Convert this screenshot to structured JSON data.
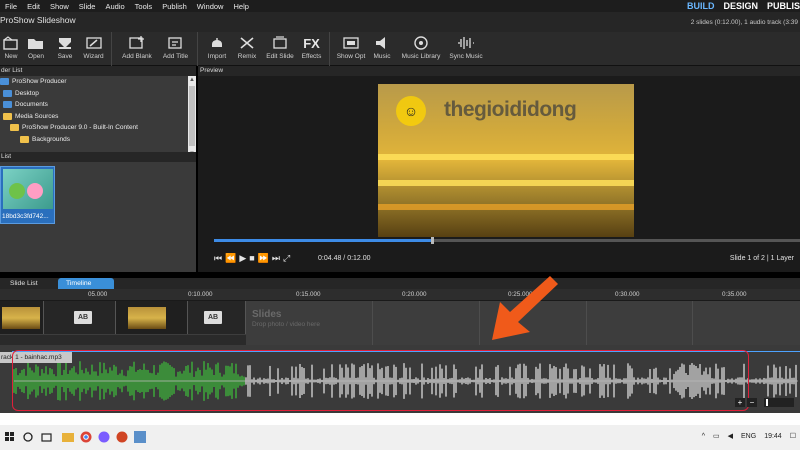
{
  "menu": {
    "items": [
      "File",
      "Edit",
      "Show",
      "Slide",
      "Audio",
      "Tools",
      "Publish",
      "Window",
      "Help"
    ],
    "modes": [
      "BUILD",
      "DESIGN",
      "PUBLIS"
    ]
  },
  "titlebar": {
    "title": "ProShow Slideshow",
    "info": "2 slides (0:12.00), 1 audio track (3:39"
  },
  "toolbar": {
    "buttons": [
      {
        "label": "New",
        "icon": "new-folder-icon"
      },
      {
        "label": "Open",
        "icon": "open-folder-icon"
      },
      {
        "label": "Save",
        "icon": "save-icon"
      },
      {
        "label": "Wizard",
        "icon": "wizard-icon"
      },
      {
        "label": "Add Blank",
        "icon": "add-blank-icon"
      },
      {
        "label": "Add Title",
        "icon": "add-title-icon"
      },
      {
        "label": "Import",
        "icon": "import-icon"
      },
      {
        "label": "Remix",
        "icon": "remix-icon"
      },
      {
        "label": "Edit Slide",
        "icon": "edit-slide-icon"
      },
      {
        "label": "Effects",
        "icon": "fx-icon"
      },
      {
        "label": "Show Opt",
        "icon": "show-options-icon"
      },
      {
        "label": "Music",
        "icon": "music-icon"
      },
      {
        "label": "Music Library",
        "icon": "music-library-icon"
      },
      {
        "label": "Sync Music",
        "icon": "sync-music-icon"
      }
    ],
    "fx_text": "FX"
  },
  "folder_list": {
    "header": "der List",
    "items": [
      {
        "label": "ProShow Producer",
        "icon": "app-icon"
      },
      {
        "label": "Desktop",
        "icon": "desktop-icon"
      },
      {
        "label": "Documents",
        "icon": "documents-icon"
      },
      {
        "label": "Media Sources",
        "icon": "folder-icon"
      },
      {
        "label": "ProShow Producer 9.0 - Built-In Content",
        "icon": "folder-icon"
      },
      {
        "label": "Backgrounds",
        "icon": "folder-icon"
      }
    ]
  },
  "file_list": {
    "header": "List",
    "item_name": "18bd3c3fd742..."
  },
  "preview": {
    "header": "Preview",
    "brand_text": "thegioididong",
    "timecode": "0:04.48 / 0:12.00",
    "slide_info": "Slide 1 of 2  |  1 Layer",
    "progress": 0.37
  },
  "timeline": {
    "tabs": [
      "Slide List",
      "Timeline"
    ],
    "active_tab": "Timeline",
    "ticks": [
      "05.000",
      "0:10.000",
      "0:15.000",
      "0:20.000",
      "0:25.000",
      "0:30.000",
      "0:35.000"
    ],
    "slides_placeholder_title": "Slides",
    "slides_placeholder_sub": "Drop photo / video here",
    "track_label": "rack 1 - bainhac.mp3",
    "zoom_in": "+",
    "zoom_out": "−"
  },
  "taskbar": {
    "apps": [
      "windows-icon",
      "search-icon",
      "task-view-icon",
      "file-explorer-icon",
      "chrome-icon",
      "messenger-icon",
      "powerpoint-icon",
      "proshow-icon"
    ],
    "lang": "ENG",
    "time": "19:44"
  },
  "colors": {
    "accent": "#3a8fd8",
    "highlight_box": "#e0203a",
    "arrow": "#f05a1a",
    "wave_played": "#3fc43a",
    "wave_unplayed": "#e8e8e8"
  }
}
